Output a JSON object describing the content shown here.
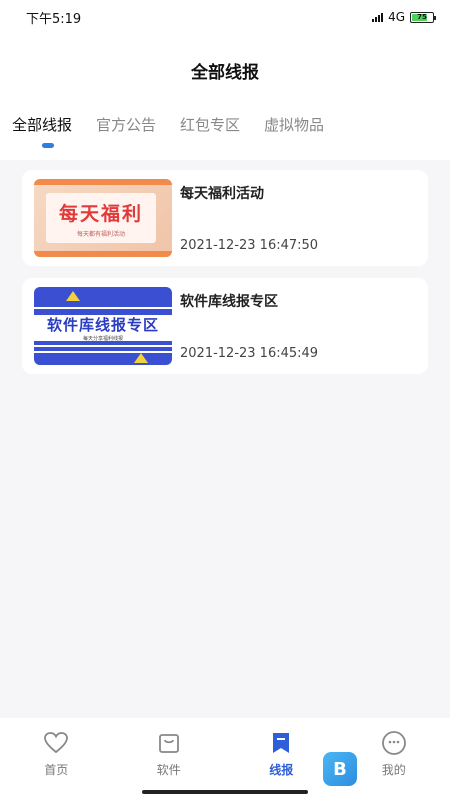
{
  "status_bar": {
    "time": "下午5:19",
    "network": "4G",
    "battery": "75"
  },
  "header": {
    "title": "全部线报"
  },
  "tabs": [
    {
      "label": "全部线报",
      "active": true
    },
    {
      "label": "官方公告",
      "active": false
    },
    {
      "label": "红包专区",
      "active": false
    },
    {
      "label": "虚拟物品",
      "active": false
    }
  ],
  "posts": [
    {
      "title": "每天福利活动",
      "time": "2021-12-23 16:47:50",
      "thumb_text": "每天福利",
      "thumb_subtext": "每天都有福利活动"
    },
    {
      "title": "软件库线报专区",
      "time": "2021-12-23 16:45:49",
      "thumb_text": "软件库线报专区",
      "thumb_subtext": "每天分享福利线报"
    }
  ],
  "bottom_nav": [
    {
      "label": "首页",
      "icon": "heart-icon",
      "active": false
    },
    {
      "label": "软件",
      "icon": "bag-icon",
      "active": false
    },
    {
      "label": "线报",
      "icon": "bookmark-icon",
      "active": true
    },
    {
      "label": "我的",
      "icon": "smiley-icon",
      "active": false
    }
  ],
  "floating_badge": {
    "letter": "B"
  },
  "colors": {
    "accent": "#2f5fd8",
    "indicator": "#2f7de1",
    "background": "#f6f6f8"
  }
}
